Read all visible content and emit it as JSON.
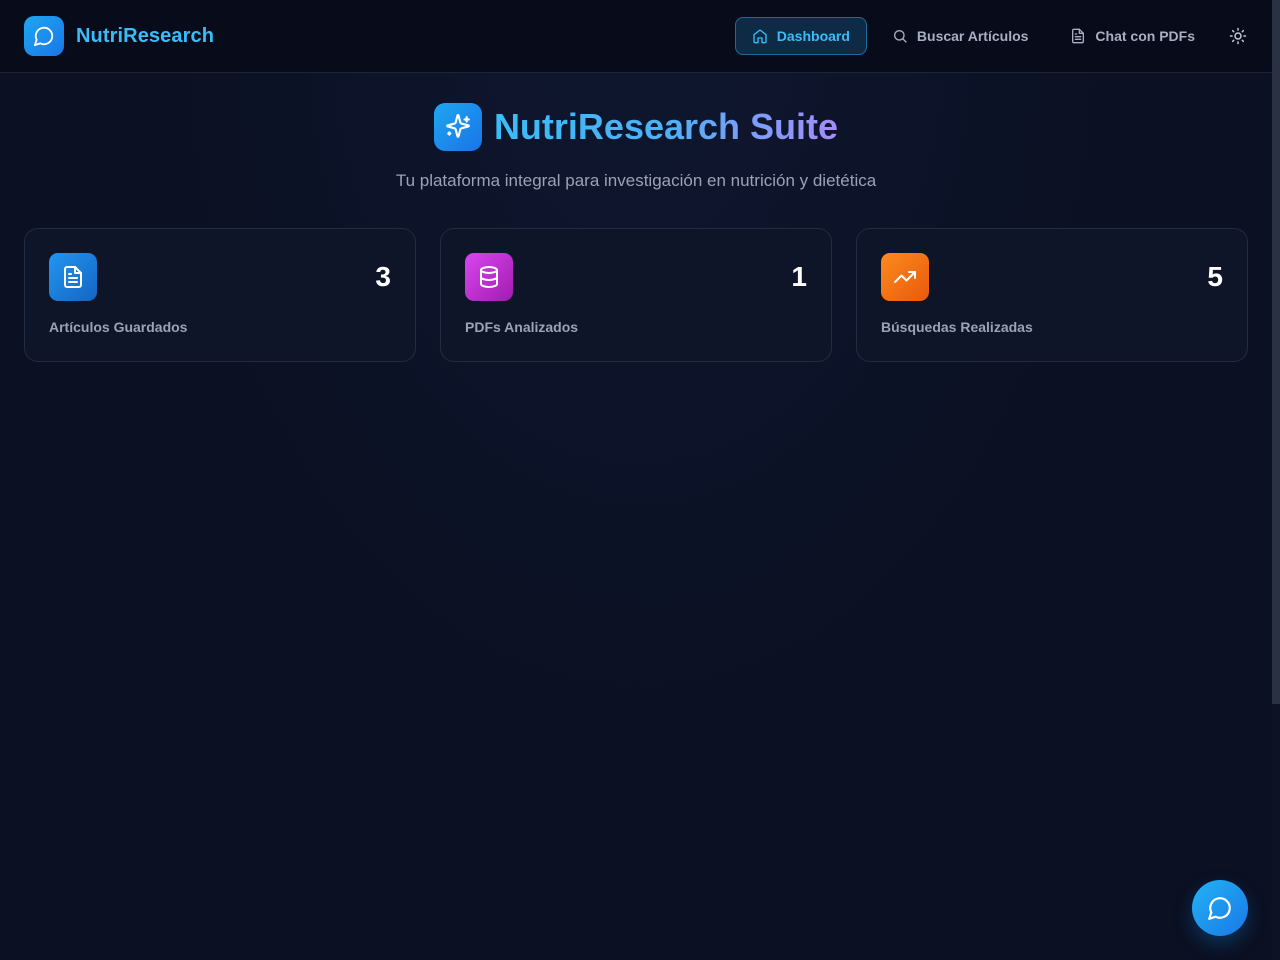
{
  "app": {
    "name": "NutriResearch",
    "logo_icon": "message-circle-icon"
  },
  "nav": {
    "items": [
      {
        "label": "Dashboard",
        "icon": "home-icon",
        "active": true
      },
      {
        "label": "Buscar Artículos",
        "icon": "search-icon",
        "active": false
      },
      {
        "label": "Chat con PDFs",
        "icon": "file-text-icon",
        "active": false
      }
    ],
    "theme_toggle_icon": "sun-icon"
  },
  "hero": {
    "title": "NutriResearch Suite",
    "subtitle": "Tu plataforma integral para investigación en nutrición y dietética",
    "icon": "sparkles-icon"
  },
  "stats": [
    {
      "value": "3",
      "label": "Artículos Guardados",
      "icon": "file-text-icon",
      "color": "#1e88e5"
    },
    {
      "value": "1",
      "label": "PDFs Analizados",
      "icon": "database-icon",
      "color": "#c03fc0"
    },
    {
      "value": "5",
      "label": "Búsquedas Realizadas",
      "icon": "trending-up-icon",
      "color": "#f07a14"
    }
  ],
  "fab": {
    "icon": "message-circle-icon"
  },
  "colors": {
    "accent": "#38bdf8",
    "background": "#0b1022",
    "header_bg": "#070b1a",
    "card_bg": "#0f1528"
  }
}
